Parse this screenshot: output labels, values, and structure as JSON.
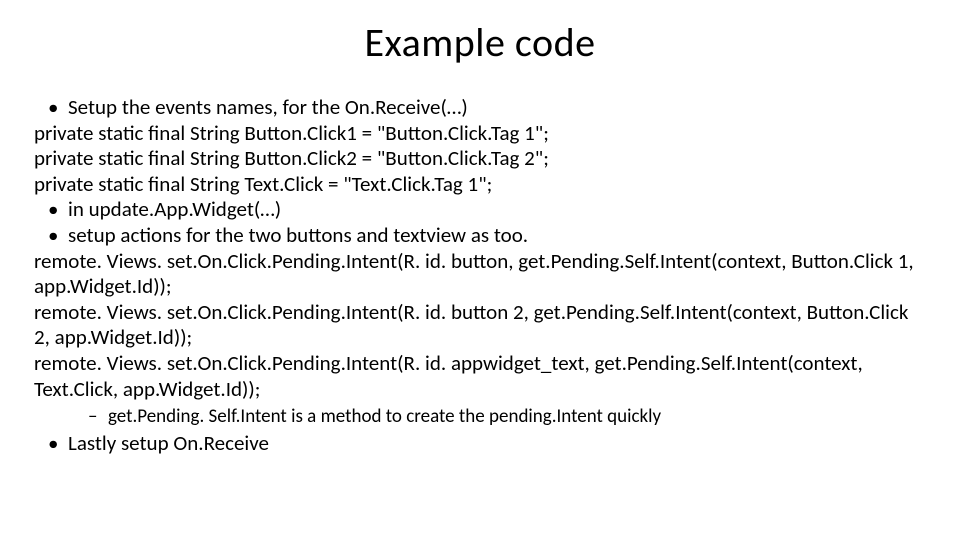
{
  "title": "Example code",
  "lines": {
    "b1": "Setup the events names, for the On.Receive(…)",
    "l1": "private static final String Button.Click1 = \"Button.Click.Tag 1\";",
    "l2": "private static final String Button.Click2 = \"Button.Click.Tag 2\";",
    "l3": "private static final String Text.Click = \"Text.Click.Tag 1\";",
    "b2": " in update.App.Widget(…)",
    "b3": "setup actions for the two buttons and textview as too.",
    "l4": "remote. Views. set.On.Click.Pending.Intent(R. id. button, get.Pending.Self.Intent(context, Button.Click 1, app.Widget.Id));",
    "l5": "remote. Views. set.On.Click.Pending.Intent(R. id. button 2, get.Pending.Self.Intent(context, Button.Click 2, app.Widget.Id));",
    "l6": "remote. Views. set.On.Click.Pending.Intent(R. id. appwidget_text, get.Pending.Self.Intent(context, Text.Click, app.Widget.Id));",
    "s1": "get.Pending. Self.Intent is a method to create the pending.Intent quickly",
    "b4": "Lastly setup On.Receive"
  }
}
